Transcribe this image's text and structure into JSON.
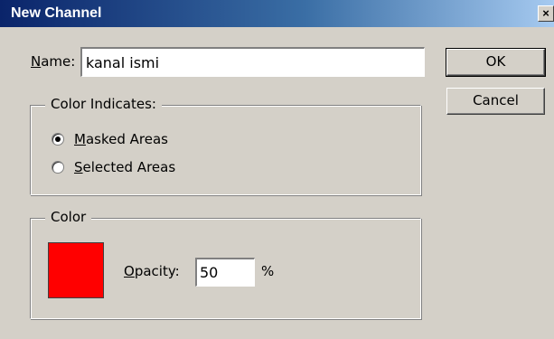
{
  "window": {
    "title": "New Channel",
    "close_glyph": "×"
  },
  "name_field": {
    "label_accel": "N",
    "label_rest": "ame:",
    "value": "kanal ismi"
  },
  "buttons": {
    "ok_label": "OK",
    "cancel_label": "Cancel"
  },
  "color_indicates": {
    "title": "Color Indicates:",
    "options": [
      {
        "accel": "M",
        "rest": "asked Areas",
        "selected": true
      },
      {
        "accel": "S",
        "rest": "elected Areas",
        "selected": false
      }
    ]
  },
  "color_group": {
    "title": "Color",
    "swatch_color": "#ff0000",
    "opacity_label_accel": "O",
    "opacity_label_rest": "pacity:",
    "opacity_value": "50",
    "opacity_unit": "%"
  }
}
